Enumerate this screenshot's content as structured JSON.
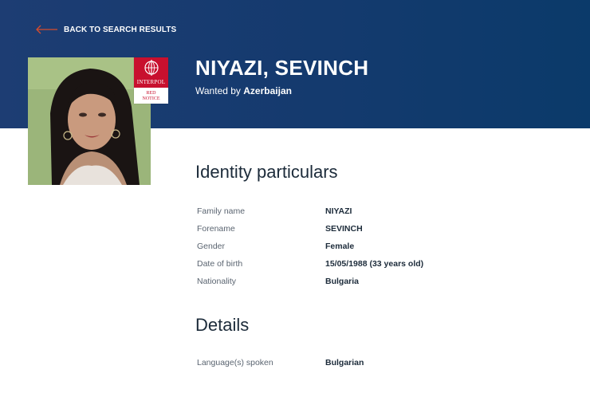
{
  "colors": {
    "hero_bg": "#143a6e",
    "back_arrow": "#d94c2b",
    "notice_red": "#c8102e"
  },
  "nav": {
    "back_label": "BACK TO SEARCH RESULTS",
    "back_icon": "arrow-left-icon"
  },
  "badge": {
    "org": "INTERPOL",
    "notice_line1": "RED",
    "notice_line2": "NOTICE"
  },
  "header": {
    "name": "NIYAZI, SEVINCH",
    "wanted_prefix": "Wanted by",
    "wanted_country": "Azerbaijan"
  },
  "identity": {
    "title": "Identity particulars",
    "rows": [
      {
        "label": "Family name",
        "value": "NIYAZI"
      },
      {
        "label": "Forename",
        "value": "SEVINCH"
      },
      {
        "label": "Gender",
        "value": "Female"
      },
      {
        "label": "Date of birth",
        "value": "15/05/1988 (33 years old)"
      },
      {
        "label": "Nationality",
        "value": "Bulgaria"
      }
    ]
  },
  "details": {
    "title": "Details",
    "rows": [
      {
        "label": "Language(s) spoken",
        "value": "Bulgarian"
      }
    ]
  }
}
